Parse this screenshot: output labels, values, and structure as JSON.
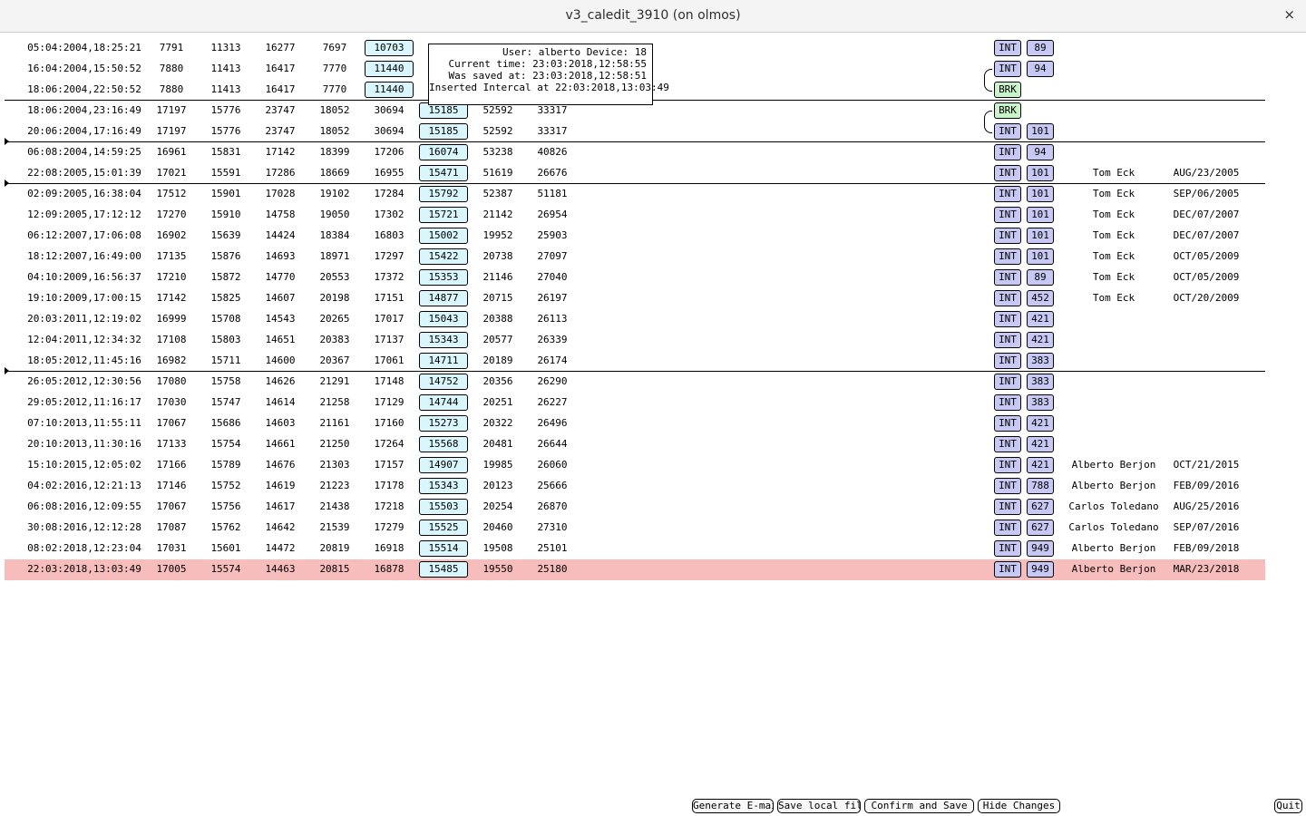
{
  "window": {
    "title": "v3_caledit_3910 (on olmos)",
    "close_glyph": "×"
  },
  "tooltip": {
    "user_line": "User: alberto Device: 18",
    "current_time_line": "Current time: 23:03:2018,12:58:55",
    "saved_line": "Was saved at: 23:03:2018,12:58:51",
    "inserted_line": "Inserted Intercal at 22:03:2018,13:03:49"
  },
  "rows": [
    {
      "date": "05:04:2004,18:25:21",
      "c1": "7791",
      "c2": "11313",
      "c3": "16277",
      "c4": "7697",
      "c5": "10703",
      "type": "INT",
      "device": "89",
      "user": "",
      "user_date": ""
    },
    {
      "date": "16:04:2004,15:50:52",
      "c1": "7880",
      "c2": "11413",
      "c3": "16417",
      "c4": "7770",
      "c5": "11440",
      "type": "INT",
      "device": "94",
      "user": "",
      "user_date": ""
    },
    {
      "date": "18:06:2004,22:50:52",
      "c1": "7880",
      "c2": "11413",
      "c3": "16417",
      "c4": "7770",
      "c5": "11440",
      "type": "BRK",
      "user": "",
      "user_date": ""
    },
    {
      "date": "18:06:2004,23:16:49",
      "c1": "17197",
      "c2": "15776",
      "c3": "23747",
      "c4": "18052",
      "c5": "30694",
      "c6": "15185",
      "c7": "52592",
      "c8": "33317",
      "type": "BRK",
      "user": "",
      "user_date": ""
    },
    {
      "date": "20:06:2004,17:16:49",
      "c1": "17197",
      "c2": "15776",
      "c3": "23747",
      "c4": "18052",
      "c5": "30694",
      "c6": "15185",
      "c7": "52592",
      "c8": "33317",
      "type": "INT",
      "device": "101",
      "user": "",
      "user_date": ""
    },
    {
      "date": "06:08:2004,14:59:25",
      "c1": "16961",
      "c2": "15831",
      "c3": "17142",
      "c4": "18399",
      "c5": "17206",
      "c6": "16074",
      "c7": "53238",
      "c8": "40826",
      "type": "INT",
      "device": "94",
      "user": "",
      "user_date": ""
    },
    {
      "date": "22:08:2005,15:01:39",
      "c1": "17021",
      "c2": "15591",
      "c3": "17286",
      "c4": "18669",
      "c5": "16955",
      "c6": "15471",
      "c7": "51619",
      "c8": "26676",
      "type": "INT",
      "device": "101",
      "user": "Tom Eck",
      "user_date": "AUG/23/2005"
    },
    {
      "date": "02:09:2005,16:38:04",
      "c1": "17512",
      "c2": "15901",
      "c3": "17028",
      "c4": "19102",
      "c5": "17284",
      "c6": "15792",
      "c7": "52387",
      "c8": "51181",
      "type": "INT",
      "device": "101",
      "user": "Tom Eck",
      "user_date": "SEP/06/2005"
    },
    {
      "date": "12:09:2005,17:12:12",
      "c1": "17270",
      "c2": "15910",
      "c3": "14758",
      "c4": "19050",
      "c5": "17302",
      "c6": "15721",
      "c7": "21142",
      "c8": "26954",
      "type": "INT",
      "device": "101",
      "user": "Tom Eck",
      "user_date": "DEC/07/2007"
    },
    {
      "date": "06:12:2007,17:06:08",
      "c1": "16902",
      "c2": "15639",
      "c3": "14424",
      "c4": "18384",
      "c5": "16803",
      "c6": "15002",
      "c7": "19952",
      "c8": "25903",
      "type": "INT",
      "device": "101",
      "user": "Tom Eck",
      "user_date": "DEC/07/2007"
    },
    {
      "date": "18:12:2007,16:49:00",
      "c1": "17135",
      "c2": "15876",
      "c3": "14693",
      "c4": "18971",
      "c5": "17297",
      "c6": "15422",
      "c7": "20738",
      "c8": "27097",
      "type": "INT",
      "device": "101",
      "user": "Tom Eck",
      "user_date": "OCT/05/2009"
    },
    {
      "date": "04:10:2009,16:56:37",
      "c1": "17210",
      "c2": "15872",
      "c3": "14770",
      "c4": "20553",
      "c5": "17372",
      "c6": "15353",
      "c7": "21146",
      "c8": "27040",
      "type": "INT",
      "device": "89",
      "user": "Tom Eck",
      "user_date": "OCT/05/2009"
    },
    {
      "date": "19:10:2009,17:00:15",
      "c1": "17142",
      "c2": "15825",
      "c3": "14607",
      "c4": "20198",
      "c5": "17151",
      "c6": "14877",
      "c7": "20715",
      "c8": "26197",
      "type": "INT",
      "device": "452",
      "user": "Tom Eck",
      "user_date": "OCT/20/2009"
    },
    {
      "date": "20:03:2011,12:19:02",
      "c1": "16999",
      "c2": "15708",
      "c3": "14543",
      "c4": "20265",
      "c5": "17017",
      "c6": "15043",
      "c7": "20388",
      "c8": "26113",
      "type": "INT",
      "device": "421",
      "user": "",
      "user_date": ""
    },
    {
      "date": "12:04:2011,12:34:32",
      "c1": "17108",
      "c2": "15803",
      "c3": "14651",
      "c4": "20383",
      "c5": "17137",
      "c6": "15343",
      "c7": "20577",
      "c8": "26339",
      "type": "INT",
      "device": "421",
      "user": "",
      "user_date": ""
    },
    {
      "date": "18:05:2012,11:45:16",
      "c1": "16982",
      "c2": "15711",
      "c3": "14600",
      "c4": "20367",
      "c5": "17061",
      "c6": "14711",
      "c7": "20189",
      "c8": "26174",
      "type": "INT",
      "device": "383",
      "user": "",
      "user_date": ""
    },
    {
      "date": "26:05:2012,12:30:56",
      "c1": "17080",
      "c2": "15758",
      "c3": "14626",
      "c4": "21291",
      "c5": "17148",
      "c6": "14752",
      "c7": "20356",
      "c8": "26290",
      "type": "INT",
      "device": "383",
      "user": "",
      "user_date": ""
    },
    {
      "date": "29:05:2012,11:16:17",
      "c1": "17030",
      "c2": "15747",
      "c3": "14614",
      "c4": "21258",
      "c5": "17129",
      "c6": "14744",
      "c7": "20251",
      "c8": "26227",
      "type": "INT",
      "device": "383",
      "user": "",
      "user_date": ""
    },
    {
      "date": "07:10:2013,11:55:11",
      "c1": "17067",
      "c2": "15686",
      "c3": "14603",
      "c4": "21161",
      "c5": "17160",
      "c6": "15273",
      "c7": "20322",
      "c8": "26496",
      "type": "INT",
      "device": "421",
      "user": "",
      "user_date": ""
    },
    {
      "date": "20:10:2013,11:30:16",
      "c1": "17133",
      "c2": "15754",
      "c3": "14661",
      "c4": "21250",
      "c5": "17264",
      "c6": "15568",
      "c7": "20481",
      "c8": "26644",
      "type": "INT",
      "device": "421",
      "user": "",
      "user_date": ""
    },
    {
      "date": "15:10:2015,12:05:02",
      "c1": "17166",
      "c2": "15789",
      "c3": "14676",
      "c4": "21303",
      "c5": "17157",
      "c6": "14907",
      "c7": "19985",
      "c8": "26060",
      "type": "INT",
      "device": "421",
      "user": "Alberto Berjon",
      "user_date": "OCT/21/2015"
    },
    {
      "date": "04:02:2016,12:21:13",
      "c1": "17146",
      "c2": "15752",
      "c3": "14619",
      "c4": "21223",
      "c5": "17178",
      "c6": "15343",
      "c7": "20123",
      "c8": "25666",
      "type": "INT",
      "device": "788",
      "user": "Alberto Berjon",
      "user_date": "FEB/09/2016"
    },
    {
      "date": "06:08:2016,12:09:55",
      "c1": "17067",
      "c2": "15756",
      "c3": "14617",
      "c4": "21438",
      "c5": "17218",
      "c6": "15503",
      "c7": "20254",
      "c8": "26870",
      "type": "INT",
      "device": "627",
      "user": "Carlos Toledano",
      "user_date": "AUG/25/2016"
    },
    {
      "date": "30:08:2016,12:12:28",
      "c1": "17087",
      "c2": "15762",
      "c3": "14642",
      "c4": "21539",
      "c5": "17279",
      "c6": "15525",
      "c7": "20460",
      "c8": "27310",
      "type": "INT",
      "device": "627",
      "user": "Carlos Toledano",
      "user_date": "SEP/07/2016"
    },
    {
      "date": "08:02:2018,12:23:04",
      "c1": "17031",
      "c2": "15601",
      "c3": "14472",
      "c4": "20819",
      "c5": "16918",
      "c6": "15514",
      "c7": "19508",
      "c8": "25101",
      "type": "INT",
      "device": "949",
      "user": "Alberto Berjon",
      "user_date": "FEB/09/2018"
    },
    {
      "date": "22:03:2018,13:03:49",
      "c1": "17005",
      "c2": "15574",
      "c3": "14463",
      "c4": "20815",
      "c5": "16878",
      "c6": "15485",
      "c7": "19550",
      "c8": "25180",
      "type": "INT",
      "device": "949",
      "user": "Alberto Berjon",
      "user_date": "MAR/23/2018",
      "highlighted": true
    }
  ],
  "separators_after_rows": [
    2,
    4,
    6,
    15
  ],
  "markers_after_rows": [
    4,
    6,
    15
  ],
  "brackets": [
    [
      1,
      2
    ],
    [
      3,
      4
    ]
  ],
  "buttons": {
    "generate_email": "Generate E-mail",
    "save_local": "Save local file",
    "confirm_save": "Confirm and Save",
    "hide_changes": "Hide Changes",
    "quit": "Quit"
  },
  "colors": {
    "highlight_row": "#f7bcbc",
    "value_box": "#d8f6fb",
    "int_badge": "#c8c8f4",
    "brk_badge": "#c8f4c8"
  }
}
